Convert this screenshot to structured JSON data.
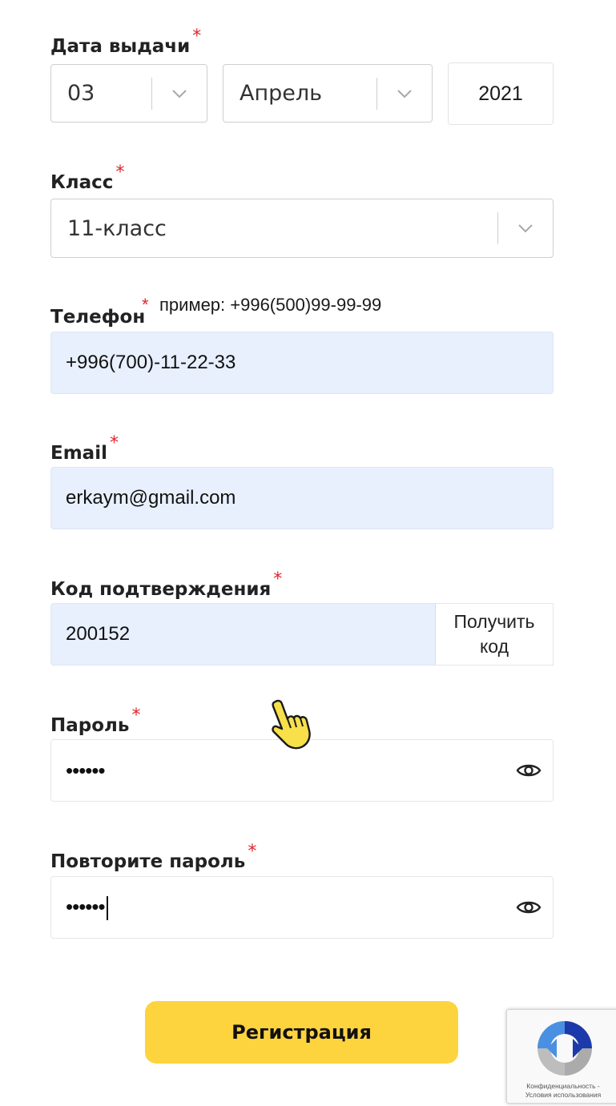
{
  "form": {
    "issue_date": {
      "label": "Дата выдачи",
      "required": "*",
      "day": "03",
      "month": "Апрель",
      "year": "2021"
    },
    "grade": {
      "label": "Класс",
      "required": "*",
      "value": "11-класс"
    },
    "phone": {
      "label": "Телефон",
      "required": "*",
      "hint": "пример: +996(500)99-99-99",
      "value": "+996(700)-11-22-33"
    },
    "email": {
      "label": "Email",
      "required": "*",
      "value": "erkaym@gmail.com"
    },
    "code": {
      "label": "Код подтверждения",
      "required": "*",
      "value": "200152",
      "button_line1": "Получить",
      "button_line2": "код"
    },
    "password": {
      "label": "Пароль",
      "required": "*",
      "masked": "••••••"
    },
    "password_repeat": {
      "label": "Повторите пароль",
      "required": "*",
      "masked": "••••••"
    },
    "submit_label": "Регистрация"
  },
  "recaptcha": {
    "caption_line1": "Конфиденциальность -",
    "caption_line2": "Условия использования"
  },
  "colors": {
    "accent": "#fdd33e",
    "required": "#e0242b",
    "autofill": "#e8f0fe"
  },
  "icons": {
    "dropdown": "chevron-down-icon",
    "visibility": "eye-icon",
    "cursor": "hand-pointer-icon",
    "captcha": "recaptcha-logo-icon"
  }
}
